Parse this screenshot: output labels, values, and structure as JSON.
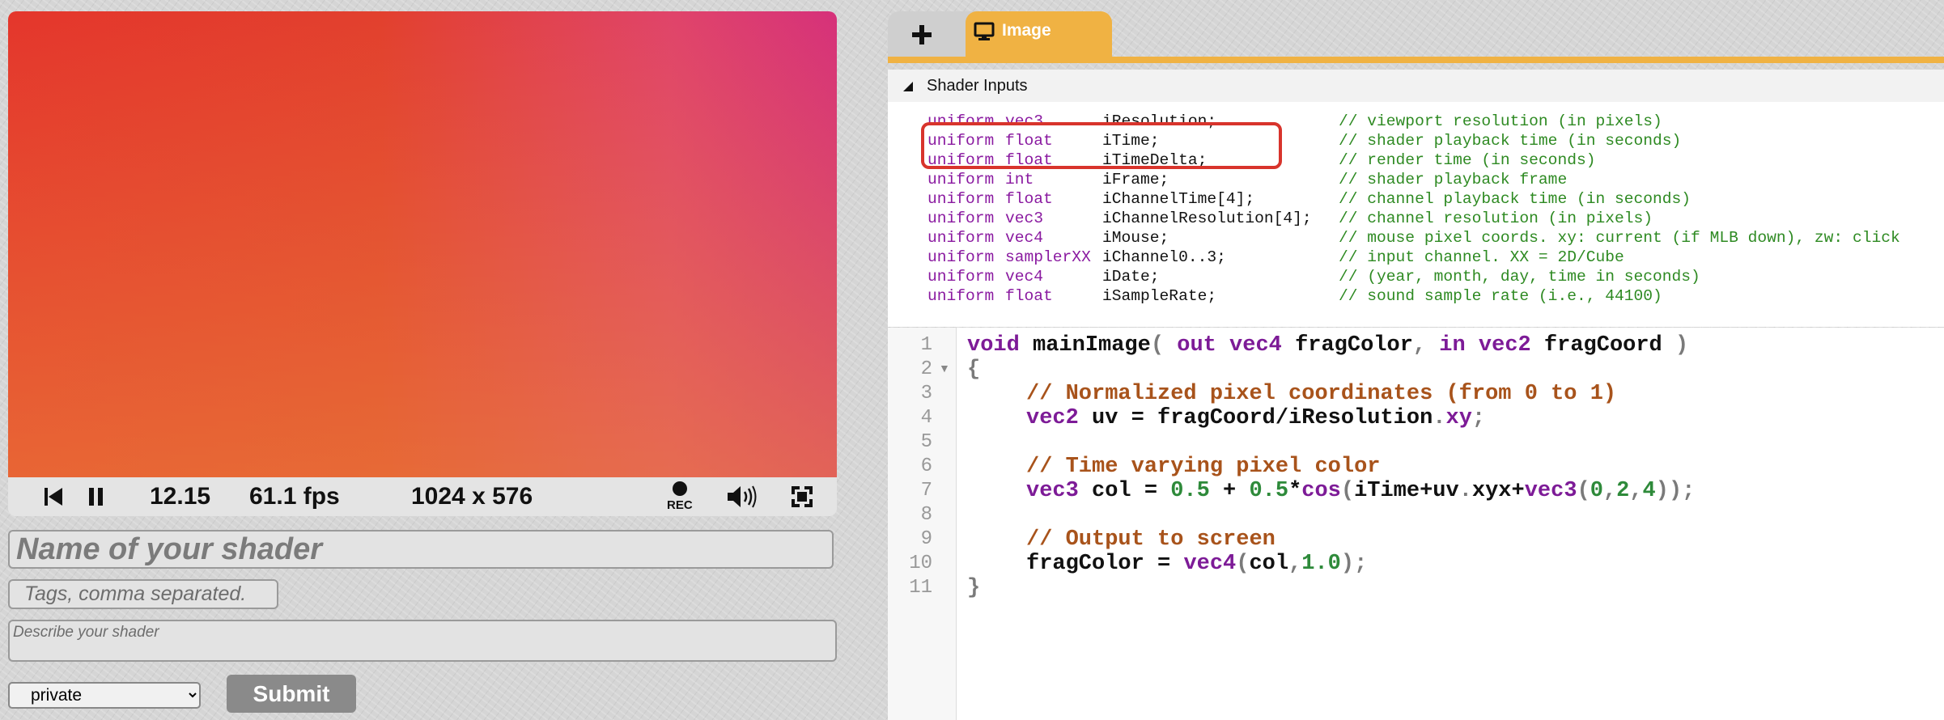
{
  "player": {
    "time": "12.15",
    "fps": "61.1 fps",
    "resolution": "1024 x 576",
    "rec_label": "REC"
  },
  "form": {
    "name_placeholder": "Name of your shader",
    "tags_placeholder": "Tags, comma separated.",
    "description_placeholder": "Describe your shader",
    "visibility_selected": "private",
    "submit_label": "Submit"
  },
  "tabs": {
    "add_label": "+",
    "image_label": "Image"
  },
  "shader_inputs": {
    "title": "Shader Inputs",
    "rows": [
      {
        "kw": "uniform",
        "type": "vec3",
        "name": "iResolution;",
        "comment": "// viewport resolution (in pixels)"
      },
      {
        "kw": "uniform",
        "type": "float",
        "name": "iTime;",
        "comment": "// shader playback time (in seconds)"
      },
      {
        "kw": "uniform",
        "type": "float",
        "name": "iTimeDelta;",
        "comment": "// render time (in seconds)"
      },
      {
        "kw": "uniform",
        "type": "int",
        "name": "iFrame;",
        "comment": "// shader playback frame"
      },
      {
        "kw": "uniform",
        "type": "float",
        "name": "iChannelTime[4];",
        "comment": "// channel playback time (in seconds)"
      },
      {
        "kw": "uniform",
        "type": "vec3",
        "name": "iChannelResolution[4];",
        "comment": "// channel resolution (in pixels)"
      },
      {
        "kw": "uniform",
        "type": "vec4",
        "name": "iMouse;",
        "comment": "// mouse pixel coords. xy: current (if MLB down), zw: click"
      },
      {
        "kw": "uniform",
        "type": "samplerXX",
        "name": "iChannel0..3;",
        "comment": "// input channel. XX = 2D/Cube"
      },
      {
        "kw": "uniform",
        "type": "vec4",
        "name": "iDate;",
        "comment": "// (year, month, day, time in seconds)"
      },
      {
        "kw": "uniform",
        "type": "float",
        "name": "iSampleRate;",
        "comment": "// sound sample rate (i.e., 44100)"
      }
    ]
  },
  "editor": {
    "line_numbers": [
      "1",
      "2",
      "3",
      "4",
      "5",
      "6",
      "7",
      "8",
      "9",
      "10",
      "11"
    ],
    "l1": {
      "a": "void",
      "b": " mainImage",
      "c": "(",
      "d": " out",
      "e": " vec4",
      "f": " fragColor",
      "g": ",",
      "h": " in",
      "i": " vec2",
      "j": " fragCoord",
      "k": " )"
    },
    "l2": "{",
    "l3": "// Normalized pixel coordinates (from 0 to 1)",
    "l4": {
      "a": "vec2",
      "b": " uv = fragCoord/iResolution",
      "c": ".",
      "d": "xy",
      "e": ";"
    },
    "l6": "// Time varying pixel color",
    "l7": {
      "a": "vec3",
      "b": " col = ",
      "c": "0.5",
      "d": " + ",
      "e": "0.5",
      "f": "*",
      "g": "cos",
      "h": "(",
      "i": "iTime+uv",
      "j": ".",
      "k": "xyx+",
      "l": "vec3",
      "m": "(",
      "n": "0",
      "o": ",",
      "p": "2",
      "q": ",",
      "r": "4",
      "s": "));"
    },
    "l9": "// Output to screen",
    "l10": {
      "a": "fragColor = ",
      "b": "vec4",
      "c": "(",
      "d": "col",
      "e": ",",
      "f": "1.0",
      "g": ");"
    },
    "l11": "}"
  }
}
